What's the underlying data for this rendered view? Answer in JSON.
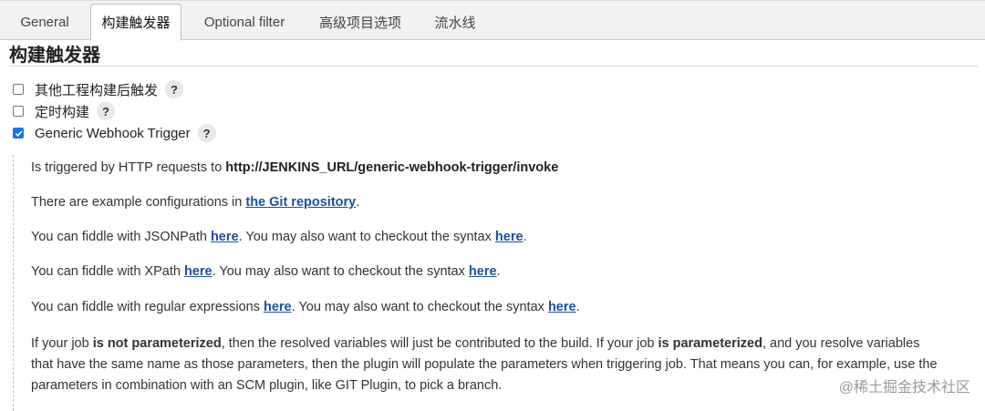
{
  "tabs": [
    {
      "label": "General"
    },
    {
      "label": "构建触发器"
    },
    {
      "label": "Optional filter"
    },
    {
      "label": "高级项目选项"
    },
    {
      "label": "流水线"
    }
  ],
  "section_title": "构建触发器",
  "options": [
    {
      "label": "其他工程构建后触发",
      "checked": false
    },
    {
      "label": "定时构建",
      "checked": false
    },
    {
      "label": "Generic Webhook Trigger",
      "checked": true
    }
  ],
  "help_glyph": "?",
  "desc": {
    "p1": {
      "text": "Is triggered by HTTP requests to ",
      "url_bold": "http://JENKINS_URL/generic-webhook-trigger/invoke"
    },
    "p2": {
      "text": "There are example configurations in ",
      "link": "the Git repository",
      "end": "."
    },
    "p3": {
      "text": "You can fiddle with JSONPath ",
      "link1": "here",
      "mid": ". You may also want to checkout the syntax ",
      "link2": "here",
      "end": "."
    },
    "p4": {
      "text": "You can fiddle with XPath ",
      "link1": "here",
      "mid": ". You may also want to checkout the syntax ",
      "link2": "here",
      "end": "."
    },
    "p5": {
      "text": "You can fiddle with regular expressions ",
      "link1": "here",
      "mid": ". You may also want to checkout the syntax ",
      "link2": "here",
      "end": "."
    },
    "p6": {
      "a": "If your job ",
      "b1": "is not parameterized",
      "c": ", then the resolved variables will just be contributed to the build. If your job ",
      "b2": "is parameterized",
      "d": ", and you resolve variables that have the same name as those parameters, then the plugin will populate the parameters when triggering job. That means you can, for example, use the parameters in combination with an SCM plugin, like GIT Plugin, to pick a branch."
    }
  },
  "watermark": "@稀土掘金技术社区",
  "colors": {
    "link": "#1f4fa0",
    "checkbox_checked": "#1a73e8",
    "tab_bar": "#f2f2f2"
  }
}
